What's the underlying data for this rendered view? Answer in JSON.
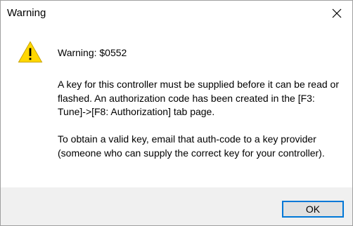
{
  "window": {
    "title": "Warning"
  },
  "icons": {
    "close": "close-icon",
    "warning": "warning-triangle-icon"
  },
  "colors": {
    "warning_fill": "#ffd700",
    "accent": "#0078d7",
    "footer_bg": "#f0f0f0"
  },
  "message": {
    "heading": "Warning: $0552",
    "paragraph_1": "A key for this controller must be supplied before it can be read or flashed. An authorization code has been created in the [F3: Tune]->[F8: Authorization] tab page.",
    "paragraph_2": "To obtain a valid key, email that auth-code to a key provider (someone who can supply the correct key for your controller)."
  },
  "buttons": {
    "ok_label": "OK"
  }
}
